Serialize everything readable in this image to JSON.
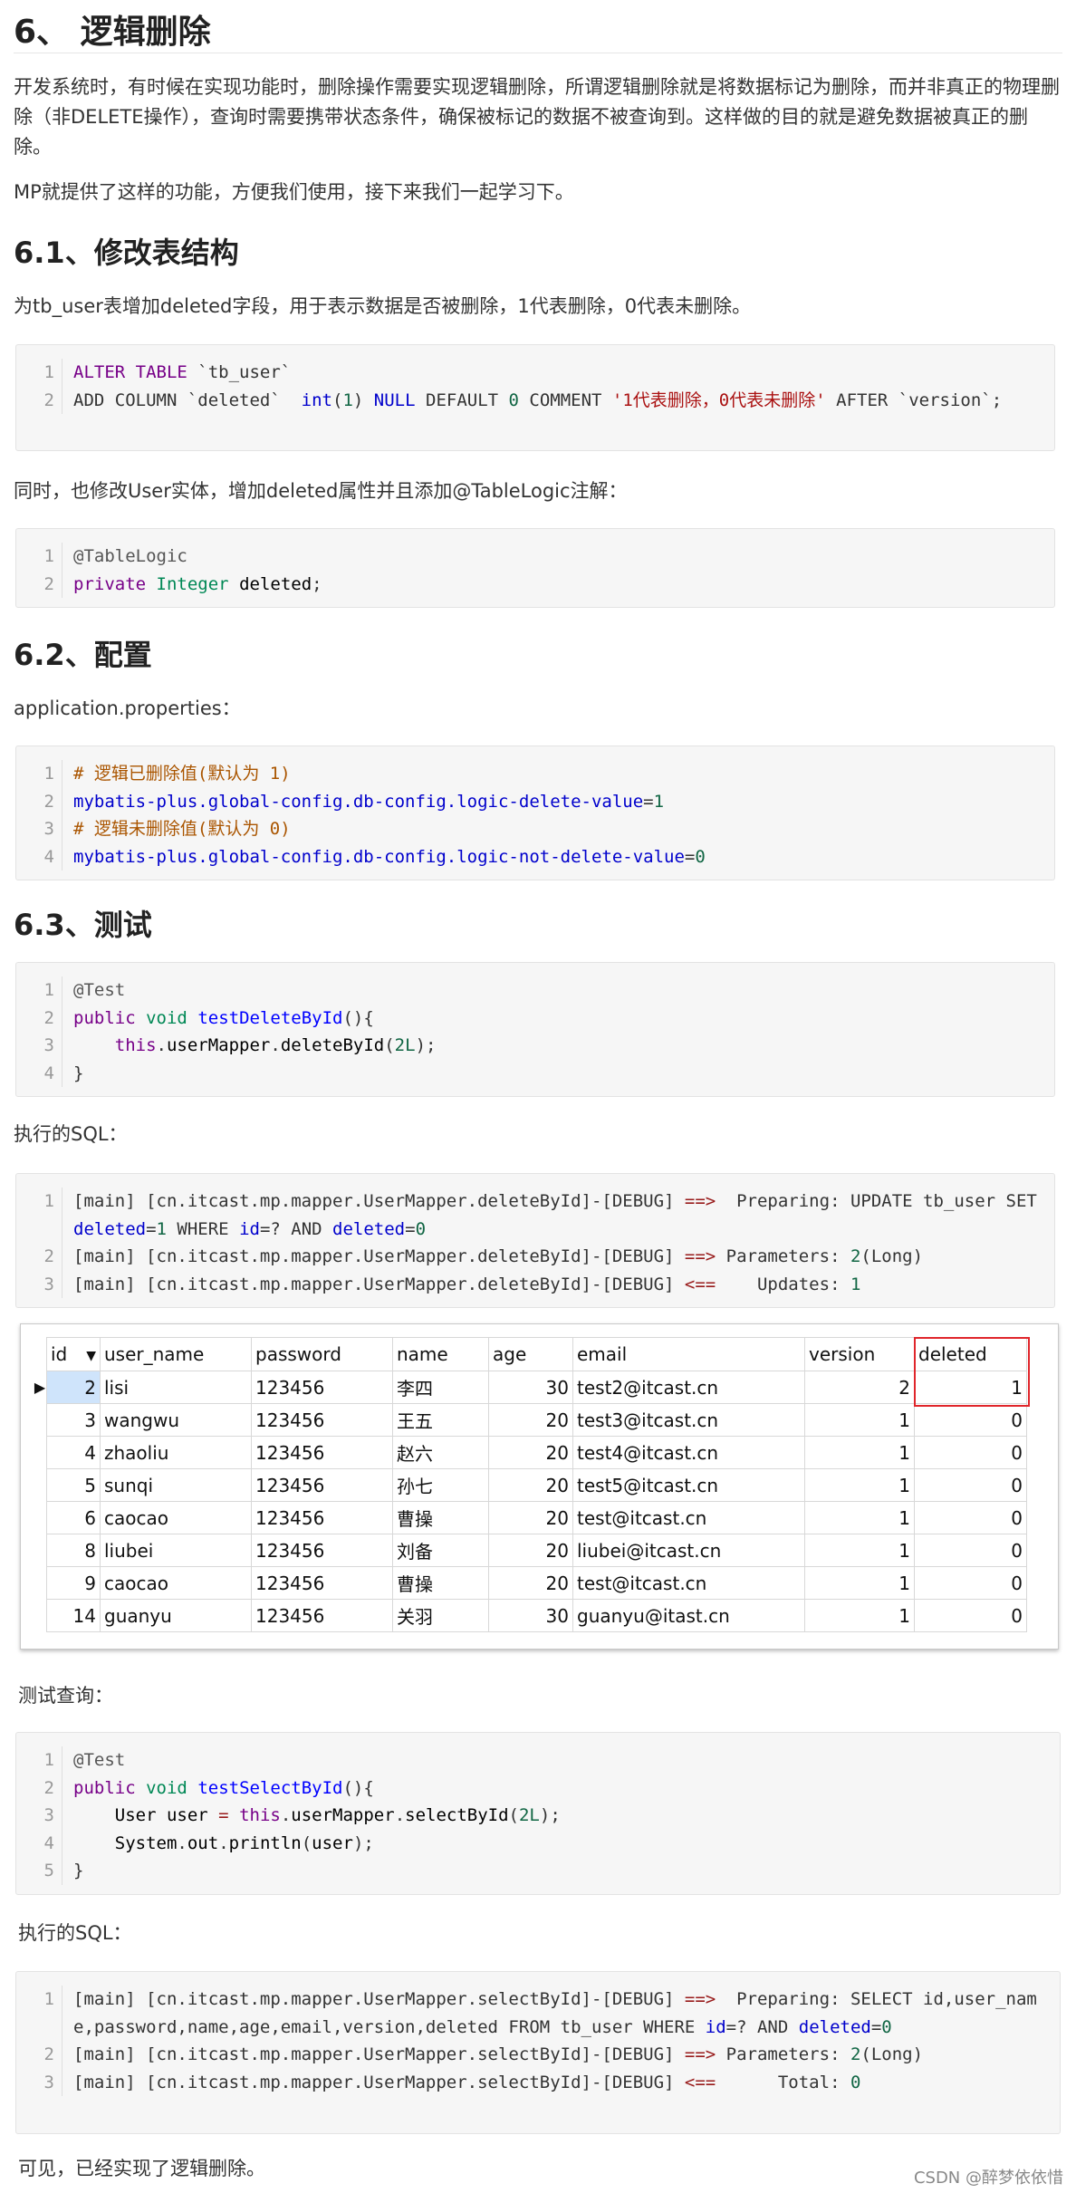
{
  "section": {
    "title": "6、 逻辑删除",
    "intro_p1": "开发系统时，有时候在实现功能时，删除操作需要实现逻辑删除，所谓逻辑删除就是将数据标记为删除，而并非真正的物理删除（非DELETE操作），查询时需要携带状态条件，确保被标记的数据不被查询到。这样做的目的就是避免数据被真正的删除。",
    "intro_p2": "MP就提供了这样的功能，方便我们使用，接下来我们一起学习下。"
  },
  "s61": {
    "title": "6.1、修改表结构",
    "desc": "为tb_user表增加deleted字段，用于表示数据是否被删除，1代表删除，0代表未删除。",
    "entity_desc": "同时，也修改User实体，增加deleted属性并且添加@TableLogic注解："
  },
  "s62": {
    "title": "6.2、配置",
    "desc": "application.properties："
  },
  "s63": {
    "title": "6.3、测试",
    "exec_sql_label": "执行的SQL：",
    "test_query_label": "测试查询：",
    "exec_sql_label2": "执行的SQL：",
    "conclusion": "可见，已经实现了逻辑删除。"
  },
  "code_blocks": {
    "alter": [
      {
        "ln": "1",
        "html": "<span class=\"kw\">ALTER</span> <span class=\"kw\">TABLE</span> `tb_user`"
      },
      {
        "ln": "2",
        "html": "ADD COLUMN `deleted`  <span class=\"var\">int</span>(<span class=\"num\">1</span>) <span class=\"var\">NULL</span> DEFAULT <span class=\"num\">0</span> COMMENT <span class=\"str\">'1代表删除，0代表未删除'</span> AFTER `version`;"
      }
    ],
    "entity": [
      {
        "ln": "1",
        "html": "<span class=\"anno\">@TableLogic</span>"
      },
      {
        "ln": "2",
        "html": "<span class=\"kw\">private</span> <span class=\"typ\">Integer</span> <span class=\"plain\">deleted</span>;"
      }
    ],
    "props": [
      {
        "ln": "1",
        "html": "<span class=\"cmt\"># 逻辑已删除值(默认为 1)</span>"
      },
      {
        "ln": "2",
        "html": "<span class=\"prop\">mybatis-plus.global-config.db-config.logic-delete-value</span>=<span class=\"num\">1</span>"
      },
      {
        "ln": "3",
        "html": "<span class=\"cmt\"># 逻辑未删除值(默认为 0)</span>"
      },
      {
        "ln": "4",
        "html": "<span class=\"prop\">mybatis-plus.global-config.db-config.logic-not-delete-value</span>=<span class=\"num\">0</span>"
      }
    ],
    "test_delete": [
      {
        "ln": "1",
        "html": "<span class=\"anno\">@Test</span>"
      },
      {
        "ln": "2",
        "html": "<span class=\"kw\">public</span> <span class=\"typ\">void</span> <span class=\"fn\">testDeleteById</span>(){"
      },
      {
        "ln": "3",
        "html": "    <span class=\"kw\">this</span>.<span class=\"plain\">userMapper</span>.<span class=\"plain\">deleteById</span>(<span class=\"num\">2L</span>);"
      },
      {
        "ln": "4",
        "html": "}"
      }
    ],
    "sql_delete": [
      {
        "ln": "1",
        "html": "[main] [cn.itcast.mp.mapper.UserMapper.deleteById]-[DEBUG] <span class=\"op\">==></span>  Preparing: UPDATE tb_user SET <span class=\"var\">deleted</span>=<span class=\"num\">1</span> WHERE <span class=\"var\">id</span>=? AND <span class=\"var\">deleted</span>=<span class=\"num\">0</span>"
      },
      {
        "ln": "2",
        "html": "[main] [cn.itcast.mp.mapper.UserMapper.deleteById]-[DEBUG] <span class=\"op\">==></span> Parameters: <span class=\"num\">2</span>(Long)"
      },
      {
        "ln": "3",
        "html": "[main] [cn.itcast.mp.mapper.UserMapper.deleteById]-[DEBUG] <span class=\"op\">&lt;==</span>    Updates: <span class=\"num\">1</span>"
      }
    ],
    "test_select": [
      {
        "ln": "1",
        "html": "<span class=\"anno\">@Test</span>"
      },
      {
        "ln": "2",
        "html": "<span class=\"kw\">public</span> <span class=\"typ\">void</span> <span class=\"fn\">testSelectById</span>(){"
      },
      {
        "ln": "3",
        "html": "    <span class=\"plain\">User user</span> <span class=\"op\">=</span> <span class=\"kw\">this</span>.<span class=\"plain\">userMapper</span>.<span class=\"plain\">selectById</span>(<span class=\"num\">2L</span>);"
      },
      {
        "ln": "4",
        "html": "    <span class=\"plain\">System</span>.<span class=\"plain\">out</span>.<span class=\"plain\">println</span>(<span class=\"plain\">user</span>);"
      },
      {
        "ln": "5",
        "html": "}"
      }
    ],
    "sql_select": [
      {
        "ln": "1",
        "html": "[main] [cn.itcast.mp.mapper.UserMapper.selectById]-[DEBUG] <span class=\"op\">==></span>  Preparing: SELECT id,user_name,password,name,age,email,version,deleted FROM tb_user WHERE <span class=\"var\">id</span>=? AND <span class=\"var\">deleted</span>=<span class=\"num\">0</span>"
      },
      {
        "ln": "2",
        "html": "[main] [cn.itcast.mp.mapper.UserMapper.selectById]-[DEBUG] <span class=\"op\">==></span> Parameters: <span class=\"num\">2</span>(Long)"
      },
      {
        "ln": "3",
        "html": "[main] [cn.itcast.mp.mapper.UserMapper.selectById]-[DEBUG] <span class=\"op\">&lt;==</span>      Total: <span class=\"num\">0</span>"
      }
    ]
  },
  "table": {
    "columns": [
      "id",
      "user_name",
      "password",
      "name",
      "age",
      "email",
      "version",
      "deleted"
    ],
    "sort_indicator": "▼",
    "current_row_marker": "▶",
    "rows": [
      [
        "2",
        "lisi",
        "123456",
        "李四",
        "30",
        "test2@itcast.cn",
        "2",
        "1"
      ],
      [
        "3",
        "wangwu",
        "123456",
        "王五",
        "20",
        "test3@itcast.cn",
        "1",
        "0"
      ],
      [
        "4",
        "zhaoliu",
        "123456",
        "赵六",
        "20",
        "test4@itcast.cn",
        "1",
        "0"
      ],
      [
        "5",
        "sunqi",
        "123456",
        "孙七",
        "20",
        "test5@itcast.cn",
        "1",
        "0"
      ],
      [
        "6",
        "caocao",
        "123456",
        "曹操",
        "20",
        "test@itcast.cn",
        "1",
        "0"
      ],
      [
        "8",
        "liubei",
        "123456",
        "刘备",
        "20",
        "liubei@itcast.cn",
        "1",
        "0"
      ],
      [
        "9",
        "caocao",
        "123456",
        "曹操",
        "20",
        "test@itcast.cn",
        "1",
        "0"
      ],
      [
        "14",
        "guanyu",
        "123456",
        "关羽",
        "30",
        "guanyu@itast.cn",
        "1",
        "0"
      ]
    ]
  },
  "footer": {
    "credit": "CSDN @醉梦依依惜"
  }
}
